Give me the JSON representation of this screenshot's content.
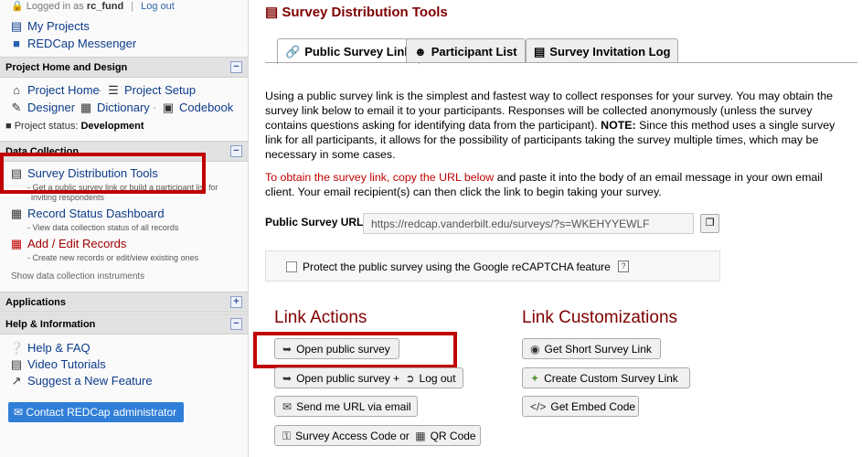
{
  "sidebar": {
    "logged_in_prefix": "Logged in as",
    "username": "rc_fund",
    "logout": "Log out",
    "my_projects": "My Projects",
    "messenger": "REDCap Messenger",
    "sections": {
      "home": "Project Home and Design",
      "data_collection": "Data Collection",
      "applications": "Applications",
      "help": "Help & Information"
    },
    "project_home": "Project Home",
    "project_setup": "Project Setup",
    "designer": "Designer",
    "dictionary": "Dictionary",
    "codebook": "Codebook",
    "status_label": "Project status:",
    "status_value": "Development",
    "survey_tools": "Survey Distribution Tools",
    "survey_tools_sub_1": "- Get a public survey link or build a participant list for",
    "survey_tools_sub_2": "inviting respondents",
    "record_status": "Record Status Dashboard",
    "record_status_sub": "- View data collection status of all records",
    "add_edit": "Add / Edit Records",
    "add_edit_sub": "- Create new records or edit/view existing ones",
    "show_instruments": "Show data collection instruments",
    "help_faq": "Help & FAQ",
    "video_tutorials": "Video Tutorials",
    "suggest_feature": "Suggest a New Feature",
    "contact_admin": "Contact REDCap administrator"
  },
  "main": {
    "title": "Survey Distribution Tools",
    "tabs": [
      {
        "label": "Public Survey Link"
      },
      {
        "label": "Participant List"
      },
      {
        "label": "Survey Invitation Log"
      }
    ],
    "intro_1": "Using a public survey link is the simplest and fastest way to collect responses for your survey. You may obtain the survey link below to email it to your participants. Responses will be collected anonymously (unless the survey contains questions asking for identifying data from the participant).",
    "note_label": "NOTE:",
    "intro_2": "Since this method uses a single survey link for all participants, it allows for the possibility of participants taking the survey multiple times, which may be necessary in some cases.",
    "instr_red": "To obtain the survey link, copy the URL below",
    "instr_rest": "and paste it into the body of an email message in your own email client. Your email recipient(s) can then click the link to begin taking your survey.",
    "url_label": "Public Survey URL:",
    "url_value": "https://redcap.vanderbilt.edu/surveys/?s=WKEHYYEWLF",
    "captcha_label": "Protect the public survey using the Google reCAPTCHA feature",
    "captcha_help": "?",
    "link_actions_heading": "Link Actions",
    "link_custom_heading": "Link Customizations",
    "open_survey": "Open public survey",
    "open_survey_logout_a": "Open public survey +",
    "open_survey_logout_b": "Log out",
    "send_url": "Send me URL via email",
    "access_code_a": "Survey Access Code or",
    "access_code_b": "QR Code",
    "short_link": "Get Short Survey Link",
    "custom_link": "Create Custom Survey Link",
    "embed_code": "Get Embed Code"
  },
  "colors": {
    "title": "#800000",
    "highlight_box": "#c00000",
    "link": "#0d3b8a",
    "contact_button": "#2f7ed8"
  }
}
